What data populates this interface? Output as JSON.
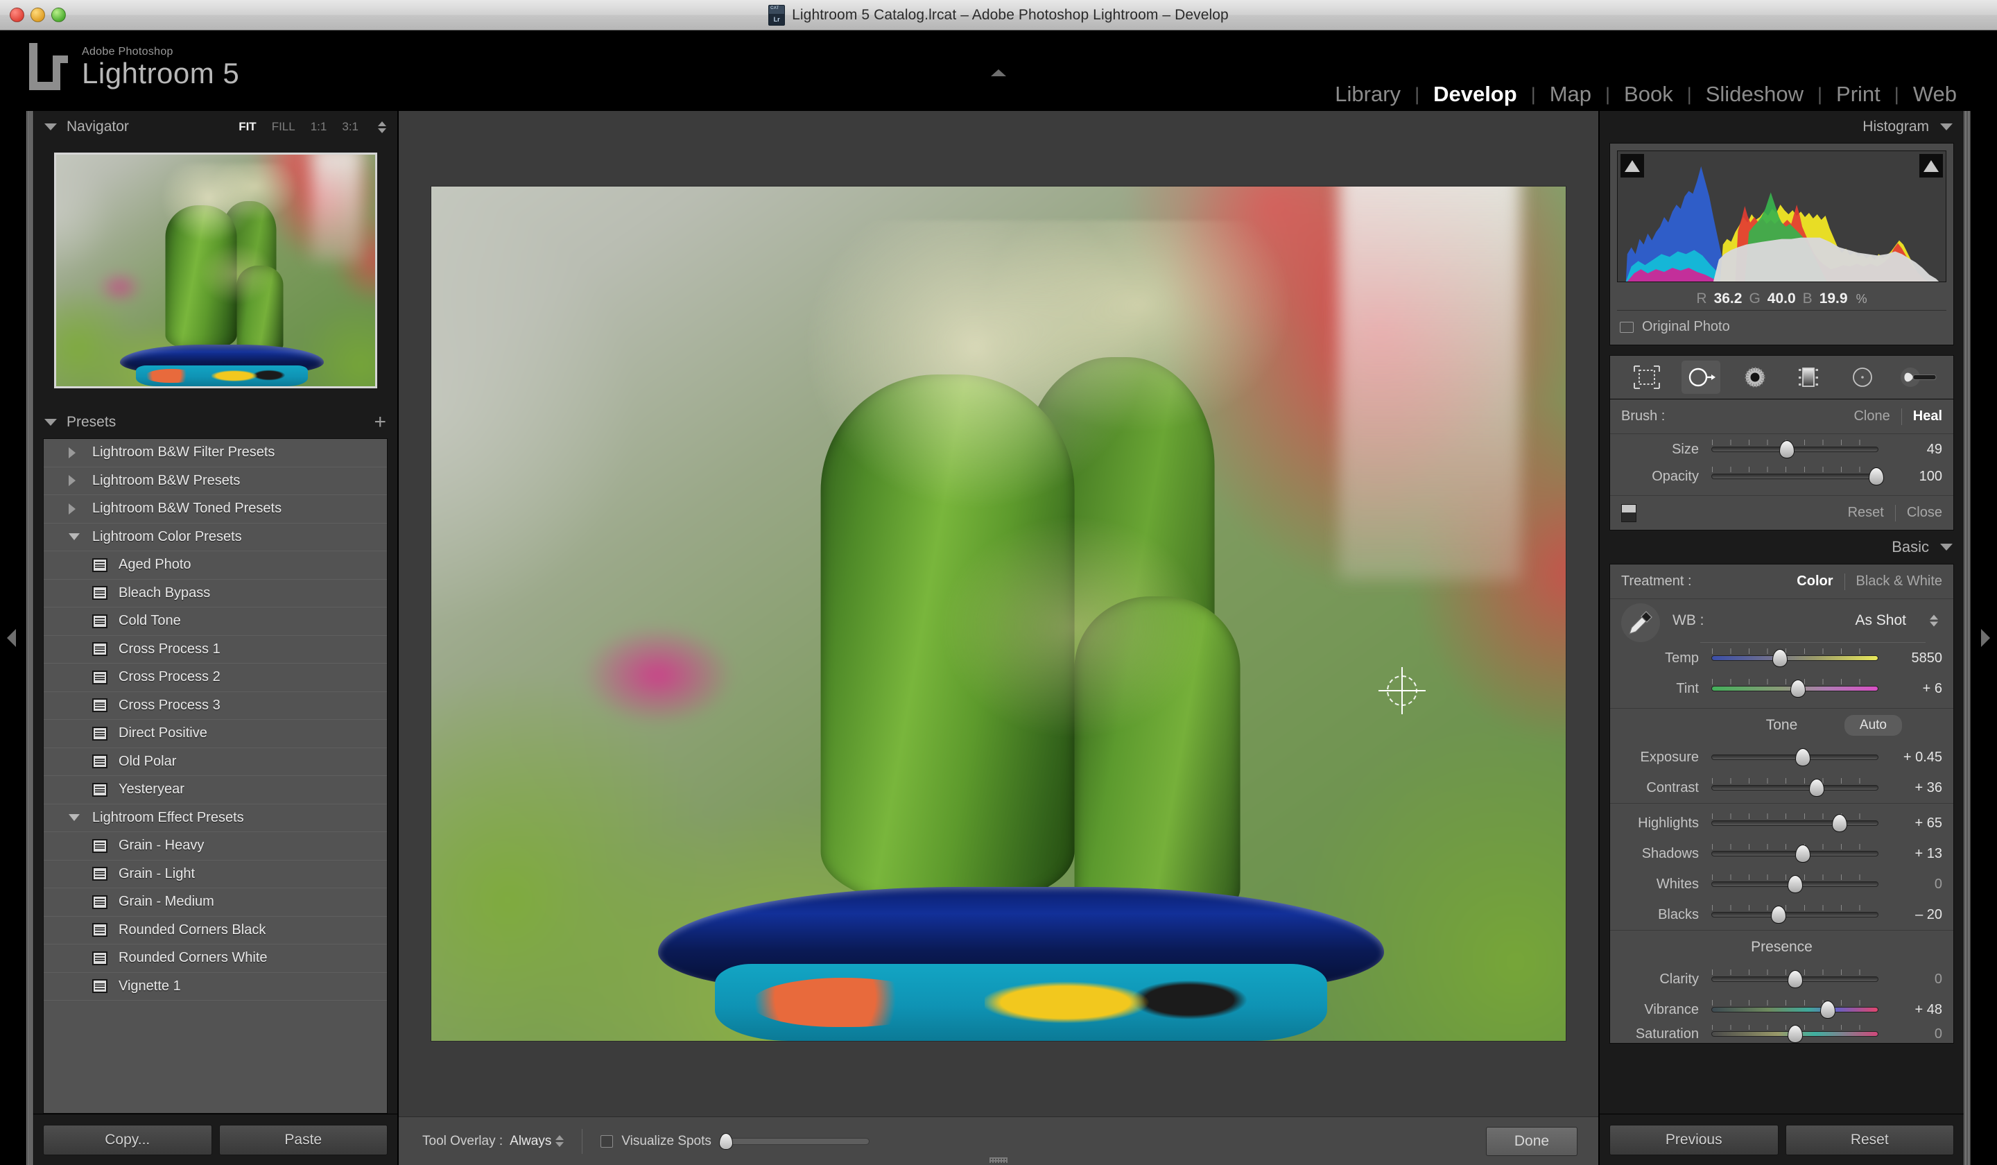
{
  "titlebar": {
    "title": "Lightroom 5 Catalog.lrcat – Adobe Photoshop Lightroom – Develop",
    "catalog_icon_top": "CAT",
    "catalog_icon_label": "Lr"
  },
  "identity": {
    "brand_small": "Adobe Photoshop",
    "brand_main": "Lightroom 5",
    "logo": "lr-logo"
  },
  "modules": [
    {
      "label": "Library",
      "active": false
    },
    {
      "label": "Develop",
      "active": true
    },
    {
      "label": "Map",
      "active": false
    },
    {
      "label": "Book",
      "active": false
    },
    {
      "label": "Slideshow",
      "active": false
    },
    {
      "label": "Print",
      "active": false
    },
    {
      "label": "Web",
      "active": false
    }
  ],
  "navigator": {
    "title": "Navigator",
    "zoom_levels": [
      {
        "label": "FIT",
        "active": true
      },
      {
        "label": "FILL",
        "active": false
      },
      {
        "label": "1:1",
        "active": false
      },
      {
        "label": "3:1",
        "active": false
      }
    ]
  },
  "presets": {
    "title": "Presets",
    "add_label": "+",
    "items": [
      {
        "label": "Lightroom B&W Filter Presets",
        "type": "group",
        "expanded": false
      },
      {
        "label": "Lightroom B&W Presets",
        "type": "group",
        "expanded": false
      },
      {
        "label": "Lightroom B&W Toned Presets",
        "type": "group",
        "expanded": false
      },
      {
        "label": "Lightroom Color Presets",
        "type": "group",
        "expanded": true
      },
      {
        "label": "Aged Photo",
        "type": "preset"
      },
      {
        "label": "Bleach Bypass",
        "type": "preset"
      },
      {
        "label": "Cold Tone",
        "type": "preset"
      },
      {
        "label": "Cross Process 1",
        "type": "preset"
      },
      {
        "label": "Cross Process 2",
        "type": "preset"
      },
      {
        "label": "Cross Process 3",
        "type": "preset"
      },
      {
        "label": "Direct Positive",
        "type": "preset"
      },
      {
        "label": "Old Polar",
        "type": "preset"
      },
      {
        "label": "Yesteryear",
        "type": "preset"
      },
      {
        "label": "Lightroom Effect Presets",
        "type": "group",
        "expanded": true
      },
      {
        "label": "Grain - Heavy",
        "type": "preset"
      },
      {
        "label": "Grain - Light",
        "type": "preset"
      },
      {
        "label": "Grain - Medium",
        "type": "preset"
      },
      {
        "label": "Rounded Corners Black",
        "type": "preset"
      },
      {
        "label": "Rounded Corners White",
        "type": "preset"
      },
      {
        "label": "Vignette 1",
        "type": "preset"
      }
    ]
  },
  "left_footer": {
    "copy_label": "Copy...",
    "paste_label": "Paste"
  },
  "histogram": {
    "title": "Histogram",
    "r_label": "R",
    "r_value": "36.2",
    "g_label": "G",
    "g_value": "40.0",
    "b_label": "B",
    "b_value": "19.9",
    "percent": "%",
    "original_photo_label": "Original Photo"
  },
  "tools": [
    {
      "name": "crop-overlay-tool",
      "selected": false
    },
    {
      "name": "spot-removal-tool",
      "selected": true
    },
    {
      "name": "red-eye-correction-tool",
      "selected": false
    },
    {
      "name": "graduated-filter-tool",
      "selected": false
    },
    {
      "name": "radial-filter-tool",
      "selected": false
    },
    {
      "name": "adjustment-brush-tool",
      "selected": false
    }
  ],
  "spot_removal": {
    "brush_label": "Brush :",
    "clone_label": "Clone",
    "heal_label": "Heal",
    "mode_active": "Heal",
    "size_label": "Size",
    "size_value": "49",
    "size_pct": 45,
    "opacity_label": "Opacity",
    "opacity_value": "100",
    "opacity_pct": 100,
    "reset_label": "Reset",
    "close_label": "Close"
  },
  "basic": {
    "title": "Basic",
    "treatment_label": "Treatment :",
    "treatment_color": "Color",
    "treatment_bw": "Black & White",
    "treatment_active": "Color",
    "wb_label": "WB :",
    "wb_value": "As Shot",
    "temp_label": "Temp",
    "temp_value": "5850",
    "temp_pct": 41,
    "tint_label": "Tint",
    "tint_value": "+ 6",
    "tint_pct": 52,
    "tone_label": "Tone",
    "auto_label": "Auto",
    "exposure_label": "Exposure",
    "exposure_value": "+ 0.45",
    "exposure_pct": 55,
    "contrast_label": "Contrast",
    "contrast_value": "+ 36",
    "contrast_pct": 63,
    "highlights_label": "Highlights",
    "highlights_value": "+ 65",
    "highlights_pct": 77,
    "shadows_label": "Shadows",
    "shadows_value": "+ 13",
    "shadows_pct": 55,
    "whites_label": "Whites",
    "whites_value": "0",
    "whites_pct": 50,
    "blacks_label": "Blacks",
    "blacks_value": "– 20",
    "blacks_pct": 40,
    "presence_label": "Presence",
    "clarity_label": "Clarity",
    "clarity_value": "0",
    "clarity_pct": 50,
    "vibrance_label": "Vibrance",
    "vibrance_value": "+ 48",
    "vibrance_pct": 70,
    "saturation_label": "Saturation",
    "saturation_value": "0",
    "saturation_pct": 50
  },
  "toolbar": {
    "tool_overlay_label": "Tool Overlay :",
    "tool_overlay_value": "Always",
    "visualize_spots_label": "Visualize Spots",
    "visualize_spots_checked": false,
    "done_label": "Done"
  },
  "right_footer": {
    "previous_label": "Previous",
    "reset_label": "Reset"
  }
}
